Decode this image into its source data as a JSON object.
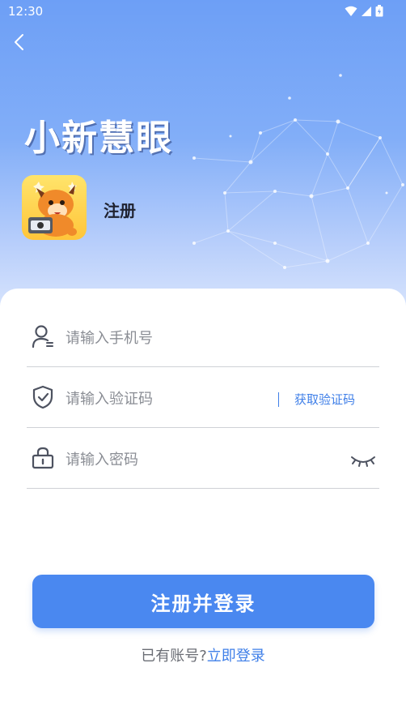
{
  "status_bar": {
    "time": "12:30"
  },
  "header": {
    "brand": "小新慧眼",
    "title": "注册"
  },
  "form": {
    "phone_placeholder": "请输入手机号",
    "code_placeholder": "请输入验证码",
    "get_code_label": "获取验证码",
    "password_placeholder": "请输入密码"
  },
  "actions": {
    "submit_label": "注册并登录",
    "have_account_text": "已有账号?",
    "login_link_label": "立即登录"
  },
  "colors": {
    "accent": "#4a88f0",
    "link": "#3f7fe8",
    "hero_top": "#6d9ff6"
  }
}
